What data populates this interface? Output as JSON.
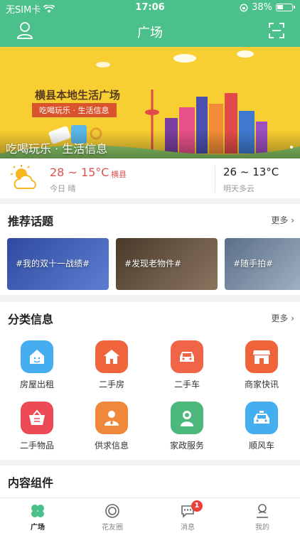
{
  "status": {
    "carrier": "无SIM卡",
    "time": "17:06",
    "battery": "38%"
  },
  "header": {
    "title": "广场",
    "user_icon": "user-icon",
    "scan_icon": "scan-icon"
  },
  "banner": {
    "title": "横县本地生活广场",
    "subtitle": "吃喝玩乐 · 生活信息",
    "caption": "吃喝玩乐 · 生活信息"
  },
  "weather": {
    "today_temp": "28 ~ 15°C",
    "location": "横县",
    "today_desc": "今日  晴",
    "tomorrow_temp": "26 ~ 13°C",
    "tomorrow_desc": "明天多云"
  },
  "topics": {
    "title": "推荐话题",
    "more": "更多 ›",
    "items": [
      {
        "label": "#我的双十一战绩#",
        "color": "#3b5aa8"
      },
      {
        "label": "#发现老物件#",
        "color": "#6b5a47"
      },
      {
        "label": "#随手拍#",
        "color": "#7a8fa6"
      }
    ]
  },
  "categories": {
    "title": "分类信息",
    "more": "更多 ›",
    "items": [
      {
        "label": "房屋出租",
        "color": "#45aef0",
        "icon": "house-rent-icon"
      },
      {
        "label": "二手房",
        "color": "#f0643c",
        "icon": "second-house-icon"
      },
      {
        "label": "二手车",
        "color": "#f06447",
        "icon": "car-icon"
      },
      {
        "label": "商家快讯",
        "color": "#f0643c",
        "icon": "shop-icon"
      },
      {
        "label": "二手物品",
        "color": "#ee4a55",
        "icon": "basket-icon"
      },
      {
        "label": "供求信息",
        "color": "#f0883c",
        "icon": "person-suit-icon"
      },
      {
        "label": "家政服务",
        "color": "#4cb87c",
        "icon": "housekeeper-icon"
      },
      {
        "label": "顺风车",
        "color": "#45aef0",
        "icon": "taxi-icon"
      }
    ]
  },
  "components": {
    "title": "内容组件"
  },
  "tabbar": {
    "items": [
      {
        "label": "广场",
        "icon": "clover-icon"
      },
      {
        "label": "花友圈",
        "icon": "circle-icon"
      },
      {
        "label": "消息",
        "icon": "message-icon",
        "badge": "1"
      },
      {
        "label": "我的",
        "icon": "profile-icon"
      }
    ]
  }
}
